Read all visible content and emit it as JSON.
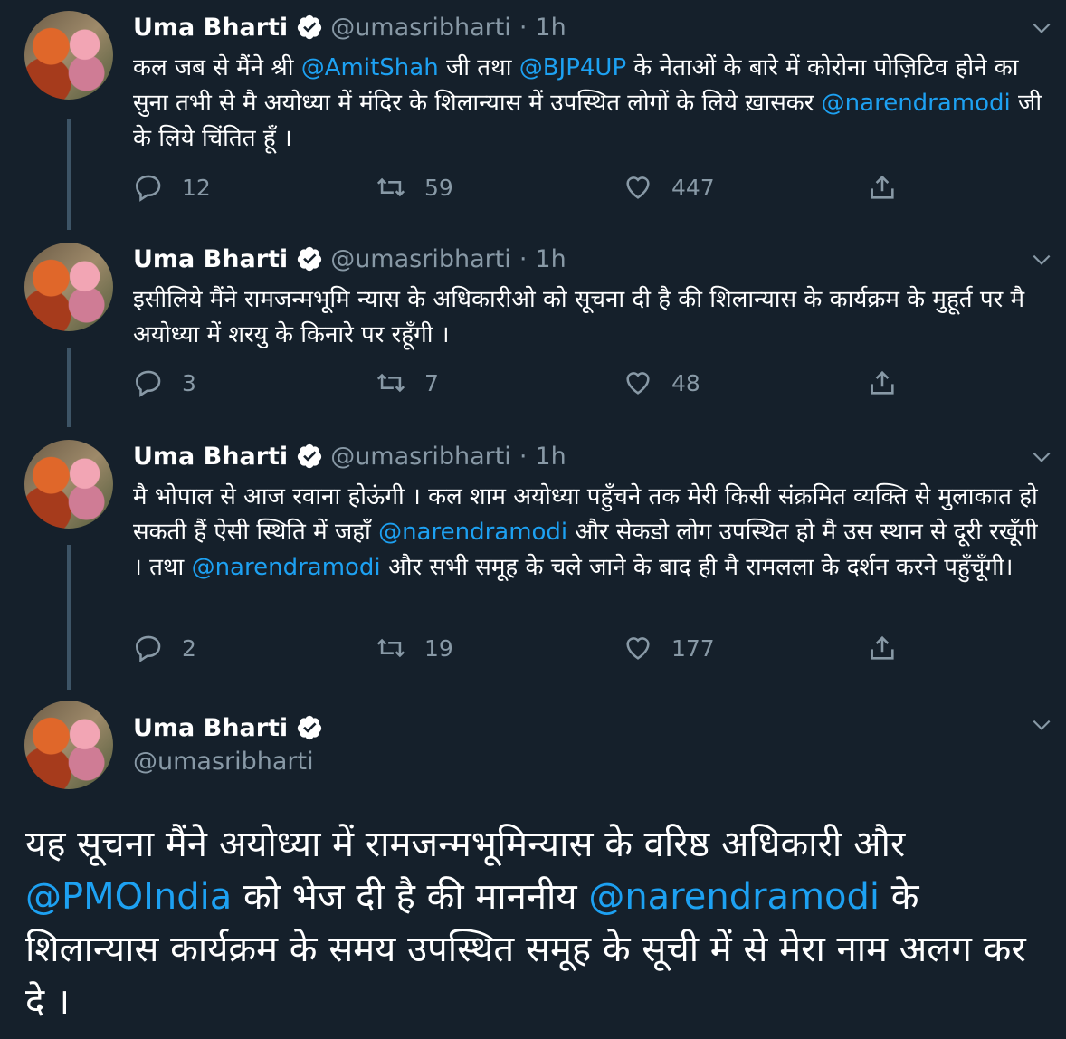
{
  "colors": {
    "background": "#15202b",
    "mention": "#1da1f2",
    "muted": "#8899a6",
    "verified": "#ffffff"
  },
  "tweets": [
    {
      "name": "Uma Bharti",
      "handle": "@umasribharti",
      "dot": "·",
      "time": "1h",
      "segments": [
        {
          "t": "कल जब से मैंने श्री ",
          "m": false
        },
        {
          "t": "@AmitShah",
          "m": true
        },
        {
          "t": " जी तथा ",
          "m": false
        },
        {
          "t": "@BJP4UP",
          "m": true
        },
        {
          "t": " के नेताओं के बारे में कोरोना पोज़िटिव होने का सुना तभी से मै अयोध्या में मंदिर के शिलान्यास में उपस्थित लोगों के लिये ख़ासकर ",
          "m": false
        },
        {
          "t": "@narendramodi",
          "m": true
        },
        {
          "t": " जी के लिये चिंतित हूँ ।",
          "m": false
        }
      ],
      "replies": "12",
      "retweets": "59",
      "likes": "447"
    },
    {
      "name": "Uma Bharti",
      "handle": "@umasribharti",
      "dot": "·",
      "time": "1h",
      "segments": [
        {
          "t": "इसीलिये मैंने रामजन्मभूमि न्यास के अधिकारीओ को सूचना दी है की शिलान्यास के कार्यक्रम के मुहूर्त पर मै अयोध्या में शरयु के किनारे पर रहूँगी ।",
          "m": false
        }
      ],
      "replies": "3",
      "retweets": "7",
      "likes": "48"
    },
    {
      "name": "Uma Bharti",
      "handle": "@umasribharti",
      "dot": "·",
      "time": "1h",
      "segments": [
        {
          "t": "मै भोपाल से आज रवाना होऊंगी । कल शाम अयोध्या पहुँचने तक मेरी किसी संक्रमित व्यक्ति से मुलाकात हो सकती हैं ऐसी स्थिति में जहाँ ",
          "m": false
        },
        {
          "t": "@narendramodi",
          "m": true
        },
        {
          "t": " और सेकडो लोग उपस्थित हो मै उस स्थान से दूरी रखूँगी । तथा ",
          "m": false
        },
        {
          "t": "@narendramodi",
          "m": true
        },
        {
          "t": " और सभी समूह के चले जाने के बाद ही मै रामलला के दर्शन करने पहुँचूँगी।",
          "m": false
        }
      ],
      "replies": "2",
      "retweets": "19",
      "likes": "177"
    }
  ],
  "main_tweet": {
    "name": "Uma Bharti",
    "handle": "@umasribharti",
    "segments": [
      {
        "t": "यह सूचना मैंने अयोध्या में रामजन्मभूमिन्यास के वरिष्ठ अधिकारी और ",
        "m": false
      },
      {
        "t": "@PMOIndia",
        "m": true
      },
      {
        "t": " को भेज दी है की माननीय ",
        "m": false
      },
      {
        "t": "@narendramodi",
        "m": true
      },
      {
        "t": " के शिलान्यास कार्यक्रम के समय उपस्थित समूह के सूची में से मेरा नाम अलग कर दे ।",
        "m": false
      }
    ]
  }
}
